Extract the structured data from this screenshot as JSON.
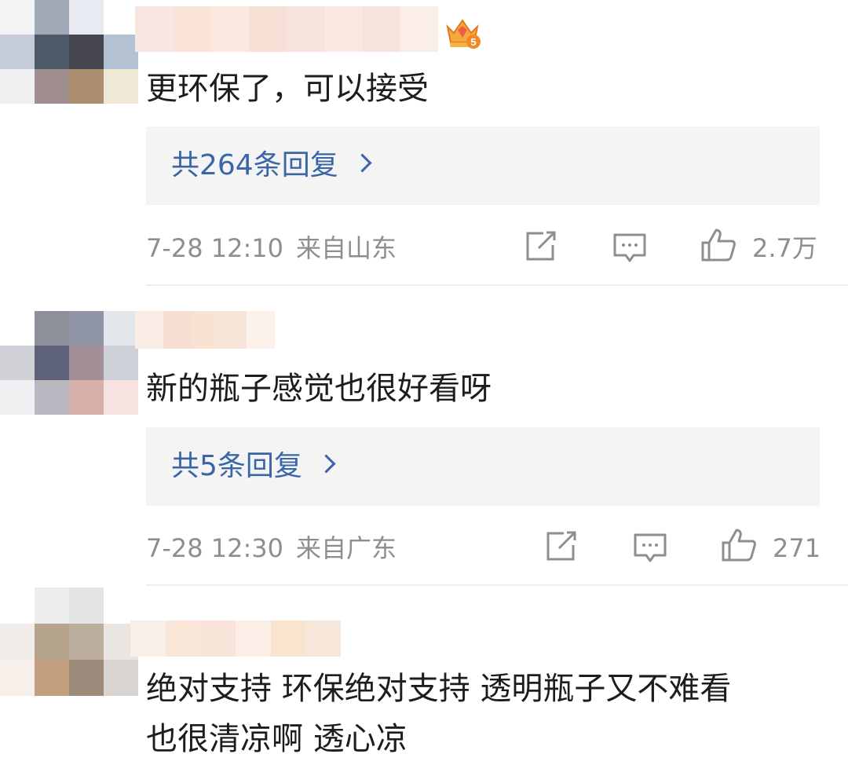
{
  "comments": [
    {
      "text": "更环保了，可以接受",
      "replies_label": "共264条回复",
      "timestamp": "7-28 12:10",
      "location": "来自山东",
      "likes": "2.7万",
      "badge_icon": "crown-level-5-icon",
      "badge_level": "5",
      "avatar_colors": [
        "#f3f3f5",
        "#a0a9b5",
        "#e7eaf0",
        "#ffffff",
        "#c5ccd8",
        "#4d5969",
        "#45464f",
        "#b4c1d3",
        "#f0f0f2",
        "#a18e8f",
        "#ad8e6f",
        "#efe8d5"
      ],
      "username_colors": [
        "#f7e6e2",
        "#f9e3d9",
        "#fbe7de",
        "#f7e1d7",
        "#f8e3dc",
        "#fbe8e1",
        "#f6e3dc",
        "#fbeee9"
      ]
    },
    {
      "text": "新的瓶子感觉也很好看呀",
      "replies_label": "共5条回复",
      "timestamp": "7-28 12:30",
      "location": "来自广东",
      "likes": "271",
      "avatar_colors": [
        "#ffffff",
        "#8c919c",
        "#8f95a5",
        "#e3e6ea",
        "#cfd1d6",
        "#5d6278",
        "#a48f98",
        "#cdd0d6",
        "#f0f0f2",
        "#b9b8c1",
        "#d6b0aa",
        "#f7e2e1"
      ],
      "username_colors": [
        "#f9ece7",
        "#f6dfd2",
        "#f8e2d2",
        "#f8e5d9",
        "#fcf1eb"
      ]
    },
    {
      "text_lines": [
        "绝对支持 环保绝对支持 透明瓶子又不难看",
        "也很清凉啊 透心凉"
      ],
      "avatar_colors": [
        "#ffffff",
        "#ececec",
        "#e4e4e4",
        "#ffffff",
        "#f0ede9",
        "#b7a48d",
        "#bcae9d",
        "#e9e5e0",
        "#f7f0ea",
        "#c39f7f",
        "#9d8c7c",
        "#d8d5d0"
      ],
      "username_colors": [
        "#f8efe9",
        "#f9e6d9",
        "#f8e4d8",
        "#fbeee7",
        "#f9e5cf",
        "#f7e7db"
      ]
    }
  ],
  "icons": {
    "forward": "share-square-icon",
    "comment": "comment-bubble-icon",
    "like": "thumbs-up-icon"
  }
}
